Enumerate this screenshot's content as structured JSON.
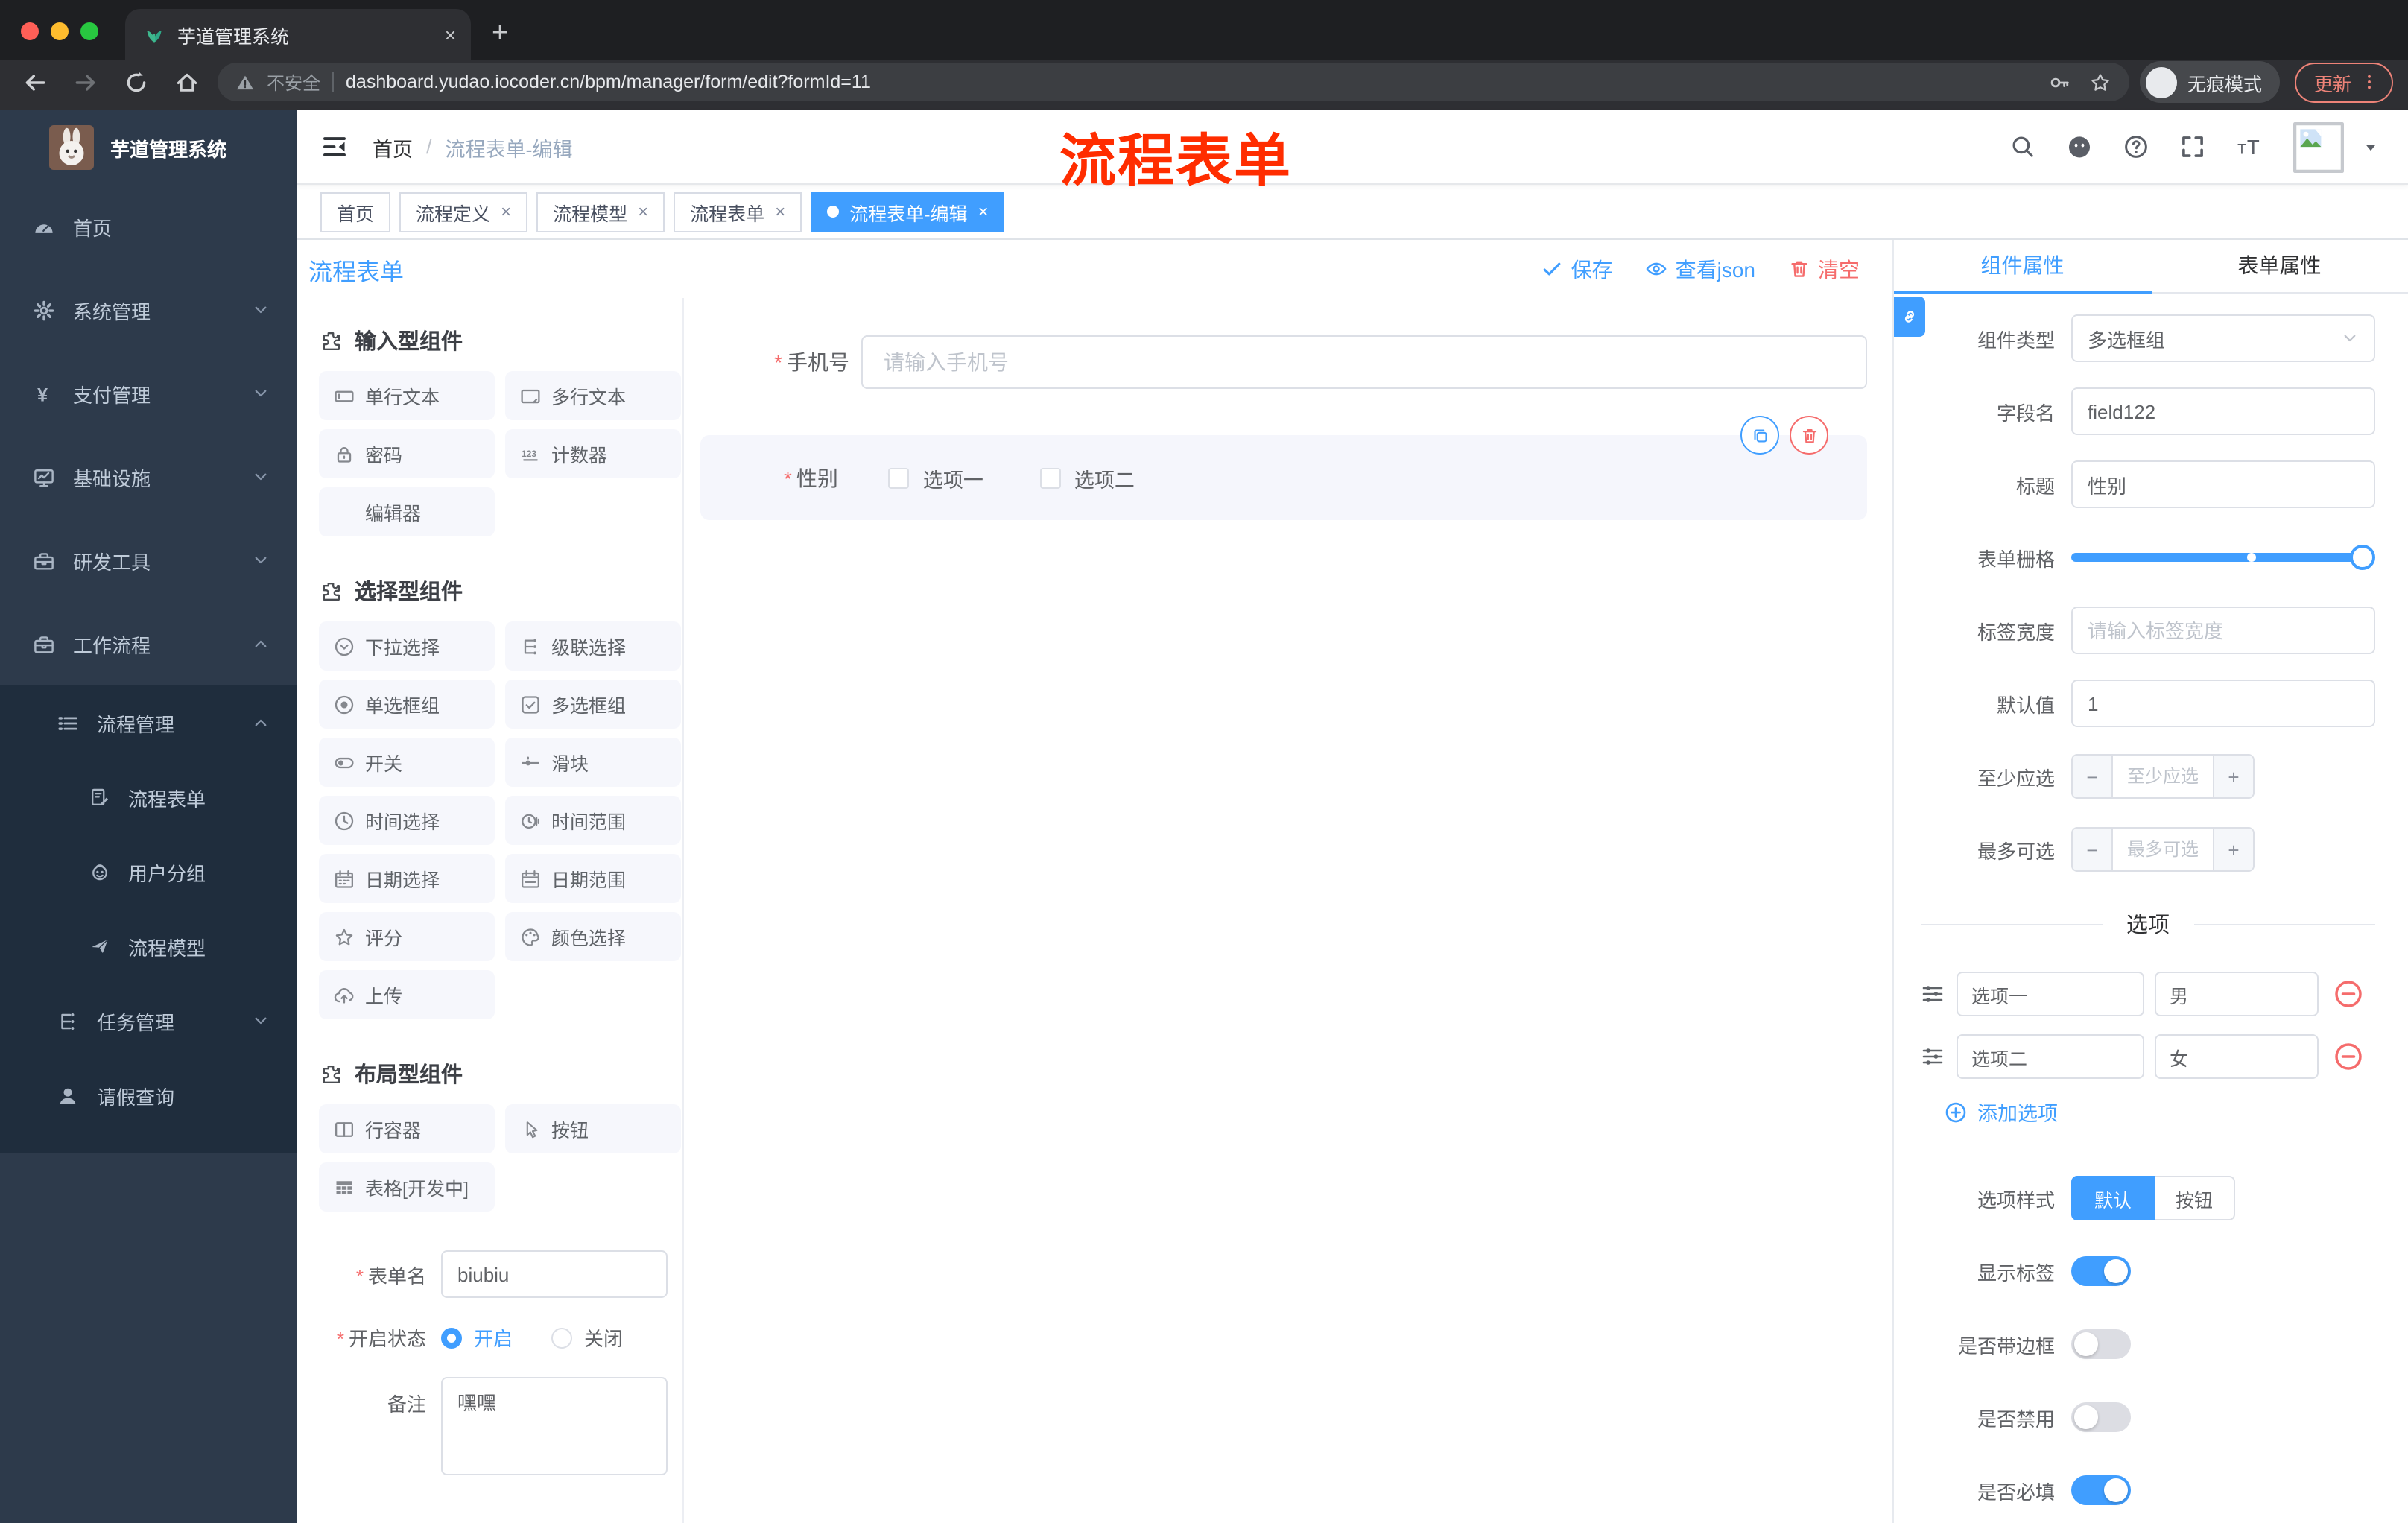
{
  "colors": {
    "accent": "#409eff",
    "danger": "#f56c6c",
    "annotation_red": "#ff2d00",
    "sidebar_bg": "#2d3a4b",
    "submenu_bg": "#1f2d3d",
    "active_tag_bg": "#409eff"
  },
  "browser": {
    "tab_title": "芋道管理系统",
    "new_tab": "+",
    "close": "×",
    "security_label": "不安全",
    "url": "dashboard.yudao.iocoder.cn/bpm/manager/form/edit?formId=11",
    "incognito_label": "无痕模式",
    "update_label": "更新"
  },
  "annotation": {
    "text": "流程表单"
  },
  "sidebar": {
    "logo_title": "芋道管理系统",
    "menu": [
      {
        "label": "首页",
        "icon": "dashboard",
        "level": 1
      },
      {
        "label": "系统管理",
        "icon": "gear",
        "level": 1,
        "chevron": "down"
      },
      {
        "label": "支付管理",
        "icon": "yen",
        "level": 1,
        "chevron": "down"
      },
      {
        "label": "基础设施",
        "icon": "monitor",
        "level": 1,
        "chevron": "down"
      },
      {
        "label": "研发工具",
        "icon": "briefcase",
        "level": 1,
        "chevron": "down"
      },
      {
        "label": "工作流程",
        "icon": "briefcase",
        "level": 1,
        "chevron": "up"
      },
      {
        "label": "流程管理",
        "icon": "list",
        "level": 2,
        "chevron": "up",
        "dark": true
      },
      {
        "label": "流程表单",
        "icon": "form",
        "level": 3,
        "dark": true
      },
      {
        "label": "用户分组",
        "icon": "robot",
        "level": 3,
        "dark": true
      },
      {
        "label": "流程模型",
        "icon": "plane",
        "level": 3,
        "dark": true
      },
      {
        "label": "任务管理",
        "icon": "tree",
        "level": 2,
        "chevron": "down",
        "dark": true
      },
      {
        "label": "请假查询",
        "icon": "user",
        "level": 2,
        "dark": true
      }
    ]
  },
  "navbar": {
    "breadcrumb": {
      "home": "首页",
      "separator": "/",
      "current": "流程表单-编辑"
    },
    "tools": [
      "search",
      "github",
      "help",
      "fullscreen",
      "fontsize"
    ]
  },
  "tags": [
    {
      "label": "首页",
      "closable": false,
      "active": false
    },
    {
      "label": "流程定义",
      "closable": true,
      "active": false
    },
    {
      "label": "流程模型",
      "closable": true,
      "active": false
    },
    {
      "label": "流程表单",
      "closable": true,
      "active": false
    },
    {
      "label": "流程表单-编辑",
      "closable": true,
      "active": true
    }
  ],
  "toolbar": {
    "title": "流程表单",
    "save_label": "保存",
    "view_json_label": "查看json",
    "clear_label": "清空"
  },
  "palette": {
    "sections": [
      {
        "title": "输入型组件",
        "items": [
          {
            "icon": "input",
            "label": "单行文本"
          },
          {
            "icon": "textarea",
            "label": "多行文本"
          },
          {
            "icon": "lock",
            "label": "密码"
          },
          {
            "icon": "counter",
            "label": "计数器"
          },
          {
            "icon": "",
            "label": "编辑器"
          }
        ]
      },
      {
        "title": "选择型组件",
        "items": [
          {
            "icon": "select",
            "label": "下拉选择"
          },
          {
            "icon": "tree",
            "label": "级联选择"
          },
          {
            "icon": "radio",
            "label": "单选框组"
          },
          {
            "icon": "checkbox",
            "label": "多选框组"
          },
          {
            "icon": "switch",
            "label": "开关"
          },
          {
            "icon": "slider",
            "label": "滑块"
          },
          {
            "icon": "clock",
            "label": "时间选择"
          },
          {
            "icon": "timerange",
            "label": "时间范围"
          },
          {
            "icon": "calendar",
            "label": "日期选择"
          },
          {
            "icon": "daterange",
            "label": "日期范围"
          },
          {
            "icon": "staro",
            "label": "评分"
          },
          {
            "icon": "palette",
            "label": "颜色选择"
          },
          {
            "icon": "upload",
            "label": "上传"
          }
        ]
      },
      {
        "title": "布局型组件",
        "items": [
          {
            "icon": "columns",
            "label": "行容器"
          },
          {
            "icon": "pointer",
            "label": "按钮"
          },
          {
            "icon": "table",
            "label": "表格[开发中]"
          }
        ]
      }
    ]
  },
  "canvas": {
    "phone_field": {
      "required": "*",
      "label": "手机号",
      "placeholder": "请输入手机号"
    },
    "selected_field": {
      "required": "*",
      "label": "性别",
      "options": [
        "选项一",
        "选项二"
      ]
    }
  },
  "form_meta": {
    "name_label": "表单名",
    "name_value": "biubiu",
    "status_label": "开启状态",
    "status_on": "开启",
    "status_off": "关闭",
    "remark_label": "备注",
    "remark_value": "嘿嘿"
  },
  "panel": {
    "tabs": [
      {
        "label": "组件属性",
        "active": true
      },
      {
        "label": "表单属性",
        "active": false
      }
    ],
    "component_type": {
      "label": "组件类型",
      "value": "多选框组"
    },
    "field_name": {
      "label": "字段名",
      "value": "field122"
    },
    "title_row": {
      "label": "标题",
      "value": "性别"
    },
    "grid_row": {
      "label": "表单栅格"
    },
    "label_width": {
      "label": "标签宽度",
      "placeholder": "请输入标签宽度"
    },
    "default_value": {
      "label": "默认值",
      "value": "1"
    },
    "min_select": {
      "label": "至少应选",
      "placeholder": "至少应选",
      "minus": "−",
      "plus": "+"
    },
    "max_select": {
      "label": "最多可选",
      "placeholder": "最多可选",
      "minus": "−",
      "plus": "+"
    },
    "options_divider": "选项",
    "options": [
      {
        "label": "选项一",
        "value": "男"
      },
      {
        "label": "选项二",
        "value": "女"
      }
    ],
    "add_option_label": "添加选项",
    "option_style": {
      "label": "选项样式",
      "active": "默认",
      "inactive": "按钮"
    },
    "switches": [
      {
        "label": "显示标签",
        "on": true
      },
      {
        "label": "是否带边框",
        "on": false
      },
      {
        "label": "是否禁用",
        "on": false
      },
      {
        "label": "是否必填",
        "on": true
      }
    ]
  }
}
